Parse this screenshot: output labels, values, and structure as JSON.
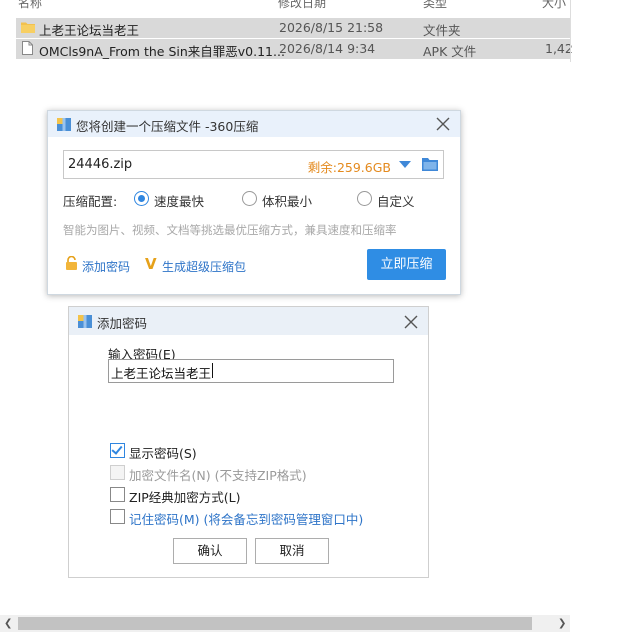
{
  "file_list": {
    "headers": {
      "name": "名称",
      "modified": "修改日期",
      "type": "类型",
      "size": "大小"
    },
    "rows": [
      {
        "name": "上老王论坛当老王",
        "modified": "2026/8/15 21:58",
        "type": "文件夹",
        "size": ""
      },
      {
        "name": "OMCls9nA_From the Sin来自罪恶v0.11...",
        "modified": "2026/8/14 9:34",
        "type": "APK 文件",
        "size": "1,42"
      }
    ]
  },
  "compress_dialog": {
    "title": "您将创建一个压缩文件 -360压缩",
    "filename": "24446.zip",
    "space_remaining": "剩余:259.6GB",
    "config_label": "压缩配置:",
    "options": [
      "速度最快",
      "体积最小",
      "自定义"
    ],
    "selected_option": "速度最快",
    "hint": "智能为图片、视频、文档等挑选最优压缩方式，兼具速度和压缩率",
    "add_password_link": "添加密码",
    "super_package_link": "生成超级压缩包",
    "compress_button": "立即压缩"
  },
  "password_dialog": {
    "title": "添加密码",
    "input_label": "输入密码(E)",
    "password_value": "上老王论坛当老王",
    "checkboxes": [
      {
        "label": "显示密码(S)",
        "checked": true,
        "enabled": true
      },
      {
        "label": "加密文件名(N) (不支持ZIP格式)",
        "checked": false,
        "enabled": false
      },
      {
        "label": "ZIP经典加密方式(L)",
        "checked": false,
        "enabled": true
      },
      {
        "label": "记住密码(M) (将会备忘到密码管理窗口中)",
        "checked": false,
        "enabled": true
      }
    ],
    "ok_button": "确认",
    "cancel_button": "取消"
  },
  "colors": {
    "accent": "#2f8de4",
    "link": "#2e74c8",
    "space_text": "#e48a1e",
    "selected_row": "#d9d9d9"
  }
}
